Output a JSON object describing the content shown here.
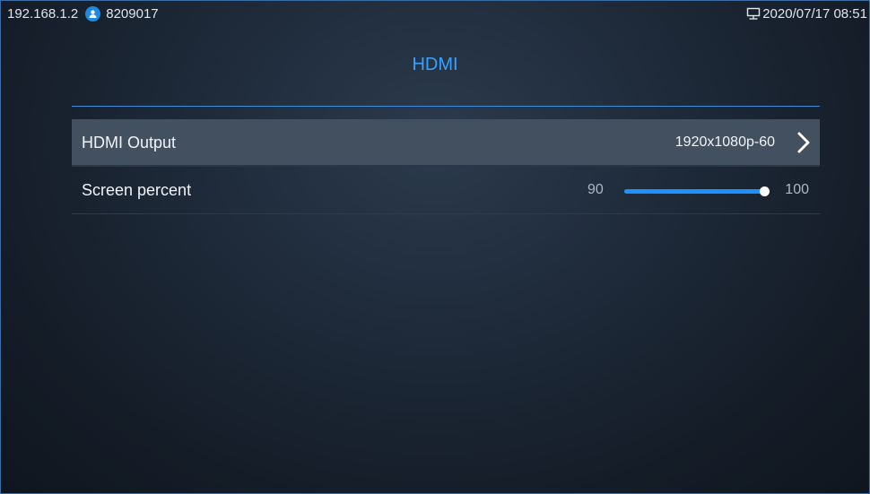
{
  "status_bar": {
    "ip": "192.168.1.2",
    "account": "8209017",
    "datetime": "2020/07/17 08:51",
    "user_icon": "user-icon",
    "monitor_icon": "monitor-icon"
  },
  "page": {
    "title": "HDMI"
  },
  "settings": {
    "hdmi_output": {
      "label": "HDMI Output",
      "value": "1920x1080p-60",
      "icon": "chevron-right-icon"
    },
    "screen_percent": {
      "label": "Screen percent",
      "min": "90",
      "max": "100",
      "level": 1.0
    }
  },
  "colors": {
    "accent": "#3aa0ff",
    "slider_fill": "#1e90ff",
    "selected_row": "#435060",
    "user_badge": "#1e88e5"
  }
}
